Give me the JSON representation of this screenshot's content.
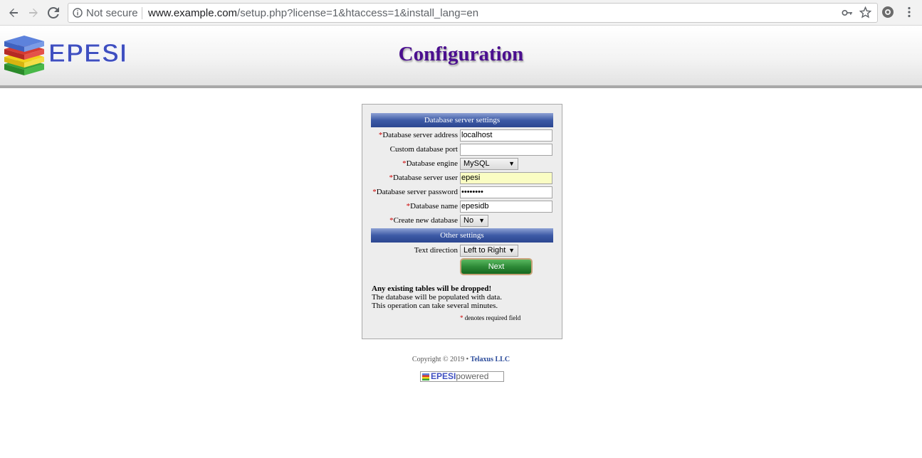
{
  "browser": {
    "security_label": "Not secure",
    "url_host": "www.example.com",
    "url_path": "/setup.php?license=1&htaccess=1&install_lang=en"
  },
  "header": {
    "logo_text": "EPESI",
    "title": "Configuration"
  },
  "form": {
    "db_section_title": "Database server settings",
    "other_section_title": "Other settings",
    "required_marker": "*",
    "fields": {
      "server_address": {
        "label": "Database server address",
        "value": "localhost"
      },
      "port": {
        "label": "Custom database port",
        "value": ""
      },
      "engine": {
        "label": "Database engine",
        "value": "MySQL"
      },
      "user": {
        "label": "Database server user",
        "value": "epesi"
      },
      "password": {
        "label": "Database server password",
        "value": "••••••••"
      },
      "db_name": {
        "label": "Database name",
        "value": "epesidb"
      },
      "create_db": {
        "label": "Create new database",
        "value": "No"
      },
      "text_direction": {
        "label": "Text direction",
        "value": "Left to Right"
      }
    },
    "next_label": "Next",
    "warning": "Any existing tables will be dropped!",
    "note_line1": "The database will be populated with data.",
    "note_line2": "This operation can take several minutes.",
    "required_note": "denotes required field"
  },
  "footer": {
    "copyright": "Copyright © 2019 •",
    "company": "Telaxus LLC",
    "powered_brand": "EPESI",
    "powered_word": "powered"
  },
  "colors": {
    "title": "#4b0f8f",
    "section_header": "#3d5aa6",
    "next_button": "#2e8a37",
    "required": "#cc0000",
    "highlight_field": "#fafdc3"
  }
}
